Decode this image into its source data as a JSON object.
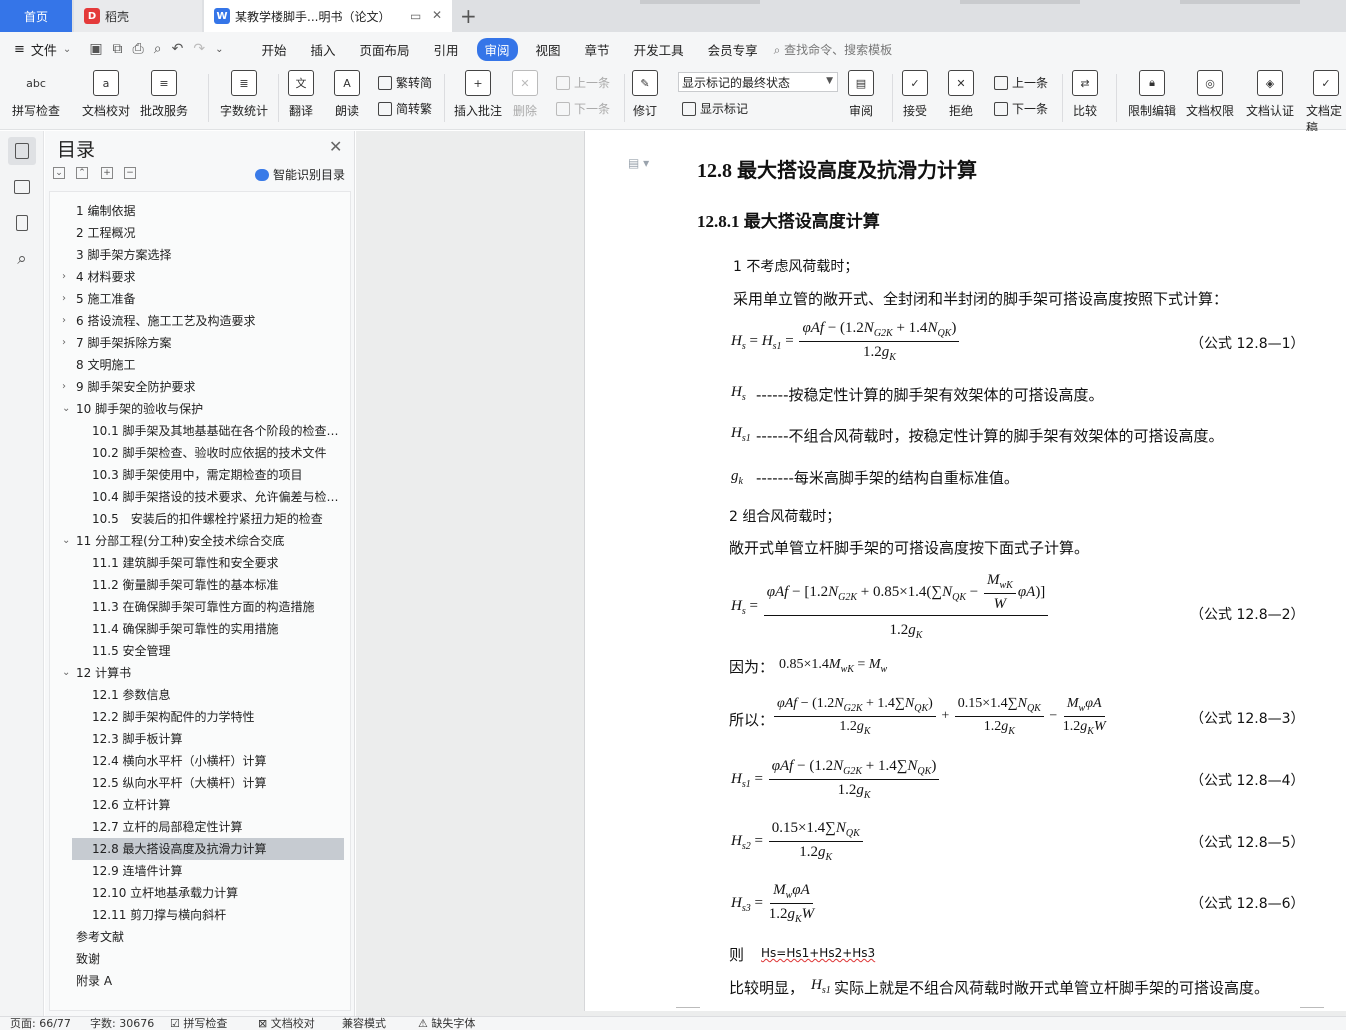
{
  "tabs": {
    "home": "首页",
    "daoke": "稻壳",
    "document": "某教学楼脚手...明书（论文）"
  },
  "menu": {
    "file": "文件",
    "items": [
      "开始",
      "插入",
      "页面布局",
      "引用",
      "审阅",
      "视图",
      "章节",
      "开发工具",
      "会员专享"
    ],
    "search": "查找命令、搜索模板"
  },
  "ribbon": {
    "spellcheck": "拼写检查",
    "doc_proof": "文档校对",
    "annotate_service": "批改服务",
    "word_count": "字数统计",
    "translate": "翻译",
    "read_aloud": "朗读",
    "to_traditional": "繁转简",
    "to_simplified": "简转繁",
    "insert_comment": "插入批注",
    "delete": "删除",
    "prev": "上一条",
    "next": "下一条",
    "revise": "修订",
    "markup_mode": "显示标记的最终状态",
    "show_markup": "显示标记",
    "review": "审阅",
    "accept": "接受",
    "reject": "拒绝",
    "prev2": "上一条",
    "next2": "下一条",
    "compare": "比较",
    "restrict_edit": "限制编辑",
    "doc_permission": "文档权限",
    "doc_certify": "文档认证",
    "doc_finalize": "文档定稿"
  },
  "toc": {
    "title": "目录",
    "smart": "智能识别目录",
    "items": [
      {
        "label": "1 编制依据",
        "level": 1,
        "chevron": ""
      },
      {
        "label": "2 工程概况",
        "level": 1,
        "chevron": ""
      },
      {
        "label": "3 脚手架方案选择",
        "level": 1,
        "chevron": ""
      },
      {
        "label": "4 材料要求",
        "level": 1,
        "chevron": "›"
      },
      {
        "label": "5 施工准备",
        "level": 1,
        "chevron": "›"
      },
      {
        "label": "6 搭设流程、施工工艺及构造要求",
        "level": 1,
        "chevron": "›"
      },
      {
        "label": "7 脚手架拆除方案",
        "level": 1,
        "chevron": "›"
      },
      {
        "label": "8 文明施工",
        "level": 1,
        "chevron": ""
      },
      {
        "label": "9 脚手架安全防护要求",
        "level": 1,
        "chevron": "›"
      },
      {
        "label": "10 脚手架的验收与保护",
        "level": 1,
        "chevron": "⌄"
      },
      {
        "label": "10.1 脚手架及其地基基础在各个阶段的检查与验收",
        "level": 2,
        "chevron": ""
      },
      {
        "label": "10.2 脚手架检查、验收时应依据的技术文件",
        "level": 2,
        "chevron": ""
      },
      {
        "label": "10.3 脚手架使用中，需定期检查的项目",
        "level": 2,
        "chevron": ""
      },
      {
        "label": "10.4 脚手架搭设的技术要求、允许偏差与检验方法",
        "level": 2,
        "chevron": ""
      },
      {
        "label": "10.5　安装后的扣件螺栓拧紧扭力矩的检查",
        "level": 2,
        "chevron": ""
      },
      {
        "label": "11 分部工程(分工种)安全技术综合交底",
        "level": 1,
        "chevron": "⌄"
      },
      {
        "label": "11.1 建筑脚手架可靠性和安全要求",
        "level": 2,
        "chevron": ""
      },
      {
        "label": "11.2 衡量脚手架可靠性的基本标准",
        "level": 2,
        "chevron": ""
      },
      {
        "label": "11.3 在确保脚手架可靠性方面的构造措施",
        "level": 2,
        "chevron": ""
      },
      {
        "label": "11.4 确保脚手架可靠性的实用措施",
        "level": 2,
        "chevron": ""
      },
      {
        "label": "11.5 安全管理",
        "level": 2,
        "chevron": ""
      },
      {
        "label": "12 计算书",
        "level": 1,
        "chevron": "⌄"
      },
      {
        "label": "12.1 参数信息",
        "level": 2,
        "chevron": ""
      },
      {
        "label": "12.2 脚手架构配件的力学特性",
        "level": 2,
        "chevron": ""
      },
      {
        "label": "12.3 脚手板计算",
        "level": 2,
        "chevron": ""
      },
      {
        "label": "12.4 横向水平杆（小横杆）计算",
        "level": 2,
        "chevron": ""
      },
      {
        "label": "12.5 纵向水平杆（大横杆）计算",
        "level": 2,
        "chevron": ""
      },
      {
        "label": "12.6 立杆计算",
        "level": 2,
        "chevron": ""
      },
      {
        "label": "12.7 立杆的局部稳定性计算",
        "level": 2,
        "chevron": ""
      },
      {
        "label": "12.8 最大搭设高度及抗滑力计算",
        "level": 2,
        "chevron": "",
        "selected": true
      },
      {
        "label": "12.9 连墙件计算",
        "level": 2,
        "chevron": ""
      },
      {
        "label": "12.10 立杆地基承载力计算",
        "level": 2,
        "chevron": ""
      },
      {
        "label": "12.11 剪刀撑与横向斜杆",
        "level": 2,
        "chevron": ""
      },
      {
        "label": "参考文献",
        "level": 1,
        "chevron": ""
      },
      {
        "label": "致谢",
        "level": 1,
        "chevron": ""
      },
      {
        "label": "附录 A",
        "level": 1,
        "chevron": ""
      }
    ]
  },
  "doc": {
    "heading1": "12.8 最大搭设高度及抗滑力计算",
    "heading2": "12.8.1 最大搭设高度计算",
    "p1": "1 不考虑风荷载时；",
    "p2": "采用单立管的敞开式、全封闭和半封闭的脚手架可搭设高度按照下式计算：",
    "eq1_label": "（公式 12.8—1）",
    "def1": "------按稳定性计算的脚手架有效架体的可搭设高度。",
    "def2": "------不组合风荷载时，按稳定性计算的脚手架有效架体的可搭设高度。",
    "def3": "-------每米高脚手架的结构自重标准值。",
    "p3": "2 组合风荷载时；",
    "p4": "敞开式单管立杆脚手架的可搭设高度按下面式子计算。",
    "eq2_label": "（公式 12.8—2）",
    "because": "因为：",
    "so": "所以：",
    "eq3_label": "（公式 12.8—3）",
    "eq4_label": "（公式 12.8—4）",
    "eq5_label": "（公式 12.8—5）",
    "eq6_label": "（公式 12.8—6）",
    "then": "则",
    "sum_expr": "Hs=Hs1+Hs2+Hs3",
    "conclusion_pre": "比较明显，",
    "conclusion_post": "实际上就是不组合风荷载时敞开式单管立杆脚手架的可搭设高度。"
  },
  "status": {
    "page": "页面: 66/77",
    "words": "字数: 30676",
    "spell": "拼写检查",
    "proof": "文档校对",
    "compat": "兼容模式",
    "missing_font": "缺失字体"
  },
  "colors": {
    "accent": "#3575e8",
    "selected_toc": "#c6cbd1"
  }
}
